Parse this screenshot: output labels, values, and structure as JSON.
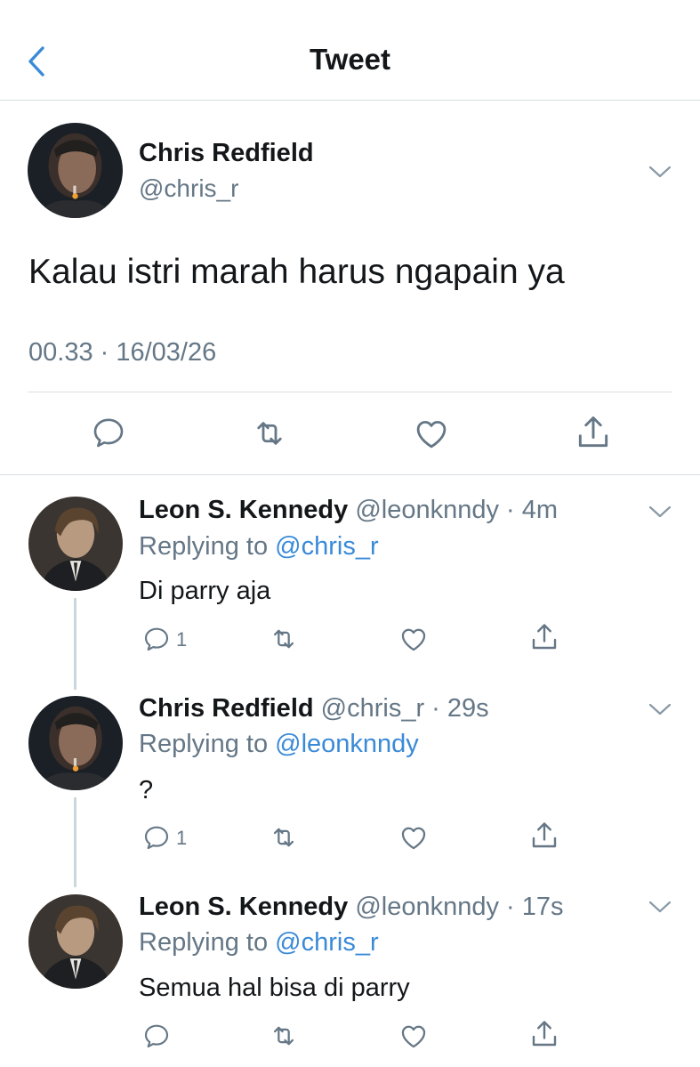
{
  "header": {
    "title": "Tweet",
    "back_icon": "chevron-left-icon",
    "accent": "#3a8ad8"
  },
  "tweet": {
    "name": "Chris Redfield",
    "handle": "@chris_r",
    "text": "Kalau istri marah harus ngapain ya",
    "timestamp": "00.33 · 16/03/26"
  },
  "replies": [
    {
      "name": "Leon S. Kennedy",
      "handle": "@leonknndy",
      "time": "4m",
      "replying_label": "Replying to",
      "replying_to": "@chris_r",
      "text": "Di parry aja",
      "reply_count": "1"
    },
    {
      "name": "Chris Redfield",
      "handle": "@chris_r",
      "time": "29s",
      "replying_label": "Replying to",
      "replying_to": "@leonknndy",
      "text": "?",
      "reply_count": "1"
    },
    {
      "name": "Leon S. Kennedy",
      "handle": "@leonknndy",
      "time": "17s",
      "replying_label": "Replying to",
      "replying_to": "@chris_r",
      "text": "Semua hal bisa di parry",
      "reply_count": ""
    }
  ],
  "colors": {
    "text": "#14171a",
    "muted": "#657786",
    "mention": "#3a8ad8",
    "divider": "#d9dde0"
  }
}
